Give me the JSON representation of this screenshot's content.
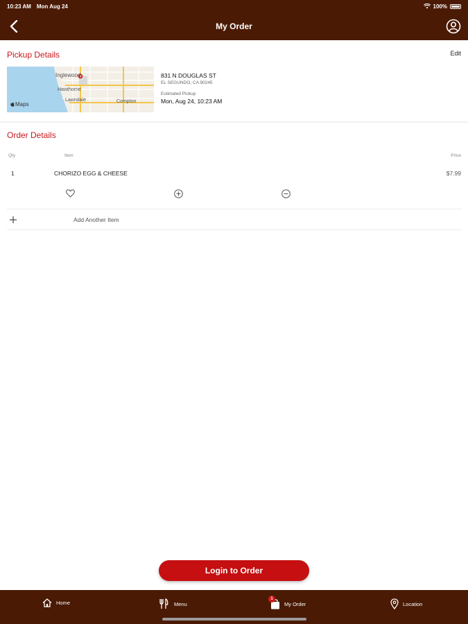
{
  "status_bar": {
    "time": "10:23 AM",
    "date": "Mon Aug 24",
    "battery": "100%"
  },
  "header": {
    "title": "My Order"
  },
  "pickup": {
    "section_title": "Pickup Details",
    "edit_label": "Edit",
    "address_line1": "831 N DOUGLAS ST",
    "address_line2": "EL SEGUNDO, CA 90245",
    "estimated_label": "Estimated Pickup",
    "estimated_value": "Mon, Aug 24, 10:23 AM",
    "map": {
      "attribution": "Maps",
      "labels": [
        "Inglewood",
        "Hawthorne",
        "Lawndale",
        "Compton"
      ]
    }
  },
  "order": {
    "section_title": "Order Details",
    "columns": {
      "qty": "Qty",
      "item": "Item",
      "price": "Price"
    },
    "items": [
      {
        "qty": "1",
        "name": "CHORIZO EGG & CHEESE",
        "price": "$7.99"
      }
    ],
    "add_item_label": "Add Another Item"
  },
  "login_button": "Login to Order",
  "tabs": [
    {
      "label": "Home",
      "icon": "home-icon"
    },
    {
      "label": "Menu",
      "icon": "menu-utensils-icon"
    },
    {
      "label": "My Order",
      "icon": "order-bag-icon",
      "badge": "1"
    },
    {
      "label": "Location",
      "icon": "location-pin-icon"
    }
  ],
  "colors": {
    "brand": "#4a1a05",
    "accent": "#c8191d",
    "button": "#c50f10"
  }
}
